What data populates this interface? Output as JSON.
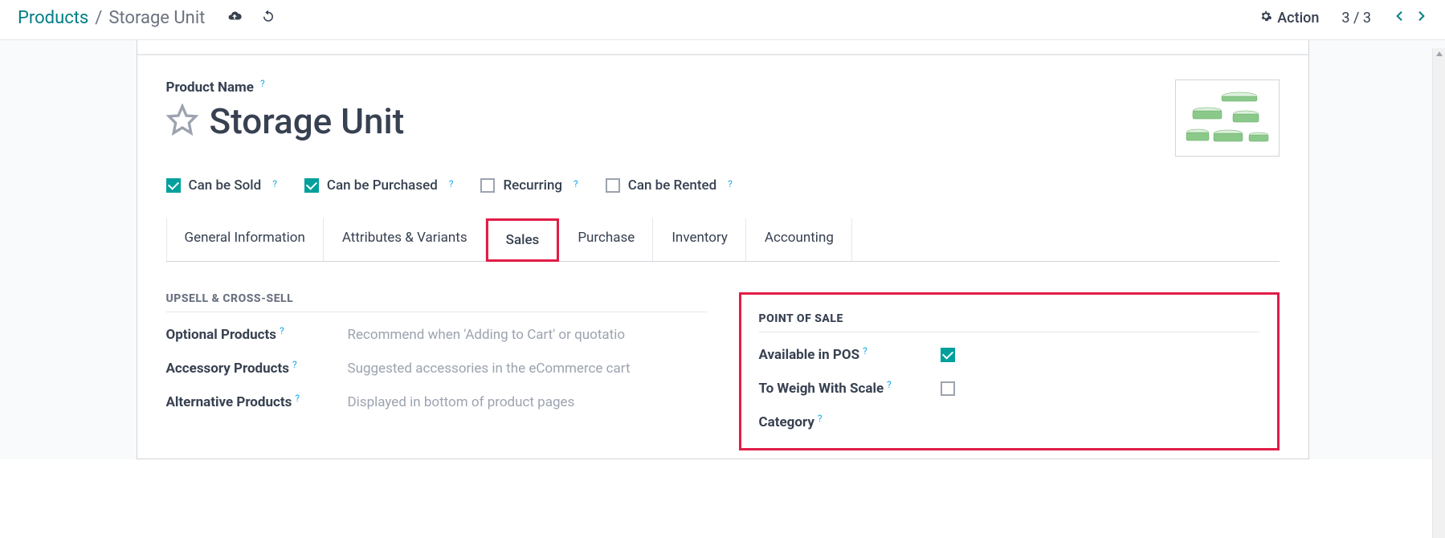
{
  "breadcrumb": {
    "root": "Products",
    "current": "Storage Unit"
  },
  "topbar": {
    "action_label": "Action",
    "pager": "3 / 3"
  },
  "product": {
    "name_label": "Product Name",
    "name": "Storage Unit"
  },
  "checks": {
    "can_be_sold": {
      "label": "Can be Sold",
      "checked": true
    },
    "can_be_purchased": {
      "label": "Can be Purchased",
      "checked": true
    },
    "recurring": {
      "label": "Recurring",
      "checked": false
    },
    "can_be_rented": {
      "label": "Can be Rented",
      "checked": false
    }
  },
  "tabs": {
    "general": "General Information",
    "attributes": "Attributes & Variants",
    "sales": "Sales",
    "purchase": "Purchase",
    "inventory": "Inventory",
    "accounting": "Accounting",
    "active": "sales"
  },
  "sales_tab": {
    "upsell_title": "UPSELL & CROSS-SELL",
    "optional_label": "Optional Products",
    "optional_placeholder": "Recommend when 'Adding to Cart' or quotatio",
    "accessory_label": "Accessory Products",
    "accessory_placeholder": "Suggested accessories in the eCommerce cart",
    "alternative_label": "Alternative Products",
    "alternative_placeholder": "Displayed in bottom of product pages",
    "pos_title": "POINT OF SALE",
    "pos_available_label": "Available in POS",
    "pos_available_checked": true,
    "pos_weigh_label": "To Weigh With Scale",
    "pos_weigh_checked": false,
    "pos_category_label": "Category"
  }
}
